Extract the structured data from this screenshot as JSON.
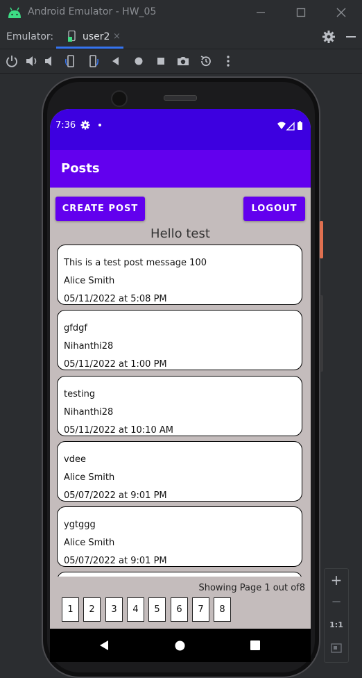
{
  "window": {
    "title": "Android Emulator - HW_05"
  },
  "tabbar": {
    "label": "Emulator:",
    "tab_label": "user2",
    "close_glyph": "×"
  },
  "toolbar": {
    "icons": [
      "power-icon",
      "volume-up-icon",
      "volume-down-icon",
      "rotate-left-icon",
      "rotate-right-icon",
      "back-icon",
      "home-icon",
      "overview-icon",
      "camera-icon",
      "snapshot-icon",
      "more-icon"
    ]
  },
  "device": {
    "status": {
      "time": "7:36"
    },
    "app_title": "Posts",
    "buttons": {
      "create_post": "CREATE POST",
      "logout": "LOGOUT"
    },
    "greeting": "Hello test",
    "posts": [
      {
        "message": "This is a test post message 100",
        "author": "Alice Smith",
        "date": "05/11/2022 at 5:08 PM"
      },
      {
        "message": "gfdgf",
        "author": "Nihanthi28",
        "date": "05/11/2022 at 1:00 PM"
      },
      {
        "message": "testing",
        "author": "Nihanthi28",
        "date": "05/11/2022 at 10:10 AM"
      },
      {
        "message": "vdee",
        "author": "Alice Smith",
        "date": "05/07/2022 at 9:01 PM"
      },
      {
        "message": "ygtggg",
        "author": "Alice Smith",
        "date": "05/07/2022 at 9:01 PM"
      }
    ],
    "page_info": "Showing Page 1 out of8",
    "pages": [
      "1",
      "2",
      "3",
      "4",
      "5",
      "6",
      "7",
      "8"
    ]
  },
  "zoom_panel": {
    "zoom_in": "+",
    "zoom_out": "−",
    "one_to_one": "1:1"
  },
  "colors": {
    "app_bar": "#6200ee",
    "status_bar": "#3d00e0",
    "content_bg": "#c4bcbc"
  }
}
